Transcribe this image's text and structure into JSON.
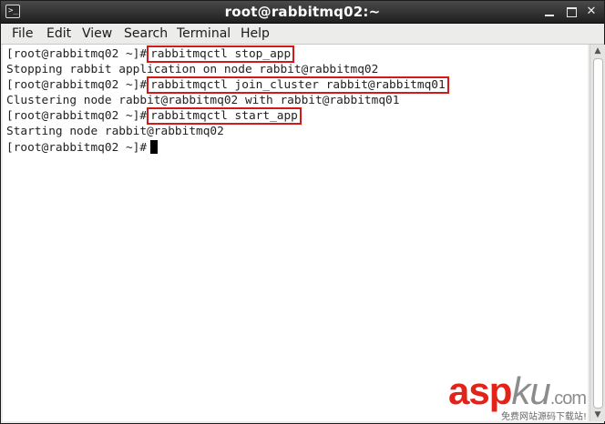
{
  "window": {
    "title": "root@rabbitmq02:~",
    "icon_name": "terminal-icon"
  },
  "menu": [
    "File",
    "Edit",
    "View",
    "Search",
    "Terminal",
    "Help"
  ],
  "terminal": {
    "prompt": "[root@rabbitmq02 ~]#",
    "lines": [
      {
        "type": "command",
        "text": "rabbitmqctl stop_app",
        "highlighted": true
      },
      {
        "type": "output",
        "text": "Stopping rabbit application on node rabbit@rabbitmq02"
      },
      {
        "type": "command",
        "text": "rabbitmqctl join_cluster rabbit@rabbitmq01",
        "highlighted": true
      },
      {
        "type": "output",
        "text": "Clustering node rabbit@rabbitmq02 with rabbit@rabbitmq01"
      },
      {
        "type": "command",
        "text": "rabbitmqctl start_app",
        "highlighted": true
      },
      {
        "type": "output",
        "text": "Starting node rabbit@rabbitmq02"
      },
      {
        "type": "prompt",
        "text": ""
      }
    ],
    "highlight_color": "#d21a1a"
  },
  "watermark": {
    "brand_main": "asp",
    "brand_tail": "ku",
    "brand_domain": ".com",
    "subtitle": "免费网站源码下载站!"
  }
}
